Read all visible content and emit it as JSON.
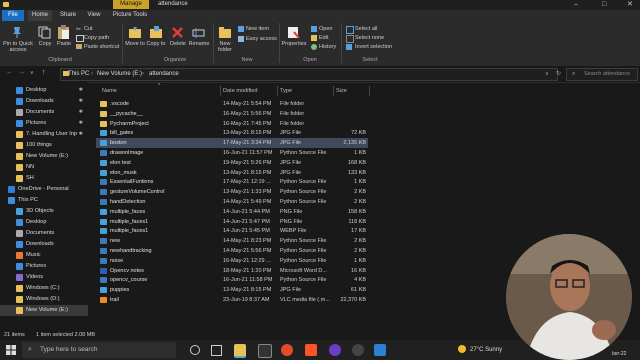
{
  "window": {
    "manage_label": "Manage",
    "title": "attendance",
    "controls": [
      "–",
      "□",
      "✕"
    ]
  },
  "tabs": [
    "File",
    "Home",
    "Share",
    "View",
    "Picture Tools"
  ],
  "ribbon": {
    "clipboard": {
      "pin_label": "Pin to Quick access",
      "copy_label": "Copy",
      "paste_label": "Paste",
      "cut_label": "Cut",
      "copy_path_label": "Copy path",
      "paste_shortcut_label": "Paste shortcut",
      "group_label": "Clipboard"
    },
    "organize": {
      "move_to_label": "Move to",
      "copy_to_label": "Copy to",
      "delete_label": "Delete",
      "rename_label": "Rename",
      "group_label": "Organize"
    },
    "new": {
      "new_folder_label": "New folder",
      "new_item_label": "New item",
      "easy_access_label": "Easy access",
      "group_label": "New"
    },
    "open": {
      "properties_label": "Properties",
      "open_label": "Open",
      "edit_label": "Edit",
      "history_label": "History",
      "group_label": "Open"
    },
    "select": {
      "select_all_label": "Select all",
      "select_none_label": "Select none",
      "invert_label": "Invert selection",
      "group_label": "Select"
    }
  },
  "address": {
    "crumbs": [
      "This PC",
      "New Volume (E:)",
      "attendance"
    ],
    "search_placeholder": "Search attendance"
  },
  "nav": [
    {
      "label": "Desktop",
      "pinned": true
    },
    {
      "label": "Downloads",
      "pinned": true
    },
    {
      "label": "Documents",
      "pinned": true
    },
    {
      "label": "Pictures",
      "pinned": true
    },
    {
      "label": "7. Handling User Inp",
      "pinned": true
    },
    {
      "label": "100 things",
      "pinned": false
    },
    {
      "label": "New Volume (E:)",
      "pinned": false
    },
    {
      "label": "NN",
      "pinned": false
    },
    {
      "label": "SH",
      "pinned": false
    },
    {
      "label": "OneDrive - Personal",
      "pinned": false
    },
    {
      "label": "This PC",
      "pinned": false
    },
    {
      "label": "3D Objects",
      "pinned": false
    },
    {
      "label": "Desktop",
      "pinned": false
    },
    {
      "label": "Documents",
      "pinned": false
    },
    {
      "label": "Downloads",
      "pinned": false
    },
    {
      "label": "Music",
      "pinned": false
    },
    {
      "label": "Pictures",
      "pinned": false
    },
    {
      "label": "Videos",
      "pinned": false
    },
    {
      "label": "Windows (C:)",
      "pinned": false
    },
    {
      "label": "Windows (D:)",
      "pinned": false
    },
    {
      "label": "New Volume (E:)",
      "pinned": false
    }
  ],
  "columns": {
    "name": "Name",
    "date": "Date modified",
    "type": "Type",
    "size": "Size"
  },
  "files": [
    {
      "name": ".vscode",
      "date": "14-May-21 5:54 PM",
      "type": "File folder",
      "size": "",
      "kind": "folder"
    },
    {
      "name": "__pycache__",
      "date": "16-May-21 5:56 PM",
      "type": "File folder",
      "size": "",
      "kind": "folder"
    },
    {
      "name": "PycharmProject",
      "date": "16-May-21 7:45 PM",
      "type": "File folder",
      "size": "",
      "kind": "folder"
    },
    {
      "name": "bill_gates",
      "date": "13-May-21 8:15 PM",
      "type": "JPG File",
      "size": "72 KB",
      "kind": "image"
    },
    {
      "name": "boston",
      "date": "17-May-21 3:34 PM",
      "type": "JPG File",
      "size": "2,135 KB",
      "kind": "image"
    },
    {
      "name": "drawonImage",
      "date": "16-Jun-21 11:57 PM",
      "type": "Python Source File",
      "size": "1 KB",
      "kind": "py"
    },
    {
      "name": "elon test",
      "date": "19-May-21 5:26 PM",
      "type": "JPG File",
      "size": "168 KB",
      "kind": "image"
    },
    {
      "name": "elon_musk",
      "date": "13-May-21 8:15 PM",
      "type": "JPG File",
      "size": "133 KB",
      "kind": "image"
    },
    {
      "name": "EssentailFuntions",
      "date": "17-May-21 12:19 ...",
      "type": "Python Source File",
      "size": "1 KB",
      "kind": "py"
    },
    {
      "name": "gestureVolumeControl",
      "date": "13-May-21 1:33 PM",
      "type": "Python Source File",
      "size": "2 KB",
      "kind": "py"
    },
    {
      "name": "handDetection",
      "date": "14-May-21 5:49 PM",
      "type": "Python Source File",
      "size": "2 KB",
      "kind": "py"
    },
    {
      "name": "multiple_faces",
      "date": "14-Jun-21 5:44 PM",
      "type": "PNG File",
      "size": "158 KB",
      "kind": "image"
    },
    {
      "name": "multiple_faces1",
      "date": "14-Jun-21 5:47 PM",
      "type": "PNG File",
      "size": "118 KB",
      "kind": "image"
    },
    {
      "name": "multiple_faces1",
      "date": "14-Jun-21 5:45 PM",
      "type": "WEBP File",
      "size": "17 KB",
      "kind": "image"
    },
    {
      "name": "new",
      "date": "14-May-21 8:23 PM",
      "type": "Python Source File",
      "size": "2 KB",
      "kind": "py"
    },
    {
      "name": "newhandtracking",
      "date": "14-May-21 5:56 PM",
      "type": "Python Source File",
      "size": "2 KB",
      "kind": "py"
    },
    {
      "name": "noise",
      "date": "16-May-21 12:29 ...",
      "type": "Python Source File",
      "size": "1 KB",
      "kind": "py"
    },
    {
      "name": "Opencv notes",
      "date": "18-May-21 1:20 PM",
      "type": "Microsoft Word D...",
      "size": "16 KB",
      "kind": "doc"
    },
    {
      "name": "opencv_course",
      "date": "16-Jun-21 11:58 PM",
      "type": "Python Source File",
      "size": "4 KB",
      "kind": "py"
    },
    {
      "name": "puppies",
      "date": "13-May-21 8:15 PM",
      "type": "JPG File",
      "size": "61 KB",
      "kind": "image"
    },
    {
      "name": "trail",
      "date": "23-Jun-19 8:37 AM",
      "type": "VLC media file (.m...",
      "size": "22,370 KB",
      "kind": "vlc"
    }
  ],
  "selected_index": 4,
  "status": {
    "items": "21 items",
    "selected": "1 item selected  2.08 MB"
  },
  "taskbar": {
    "search_placeholder": "Type here to search",
    "weather": "27°C  Sunny",
    "clock": "ber-22"
  },
  "colors": {
    "accent": "#1a6fc4",
    "manage": "#c9a227",
    "folder": "#e8c15a",
    "python": "#3d7ab8",
    "image": "#4aa0d8"
  }
}
